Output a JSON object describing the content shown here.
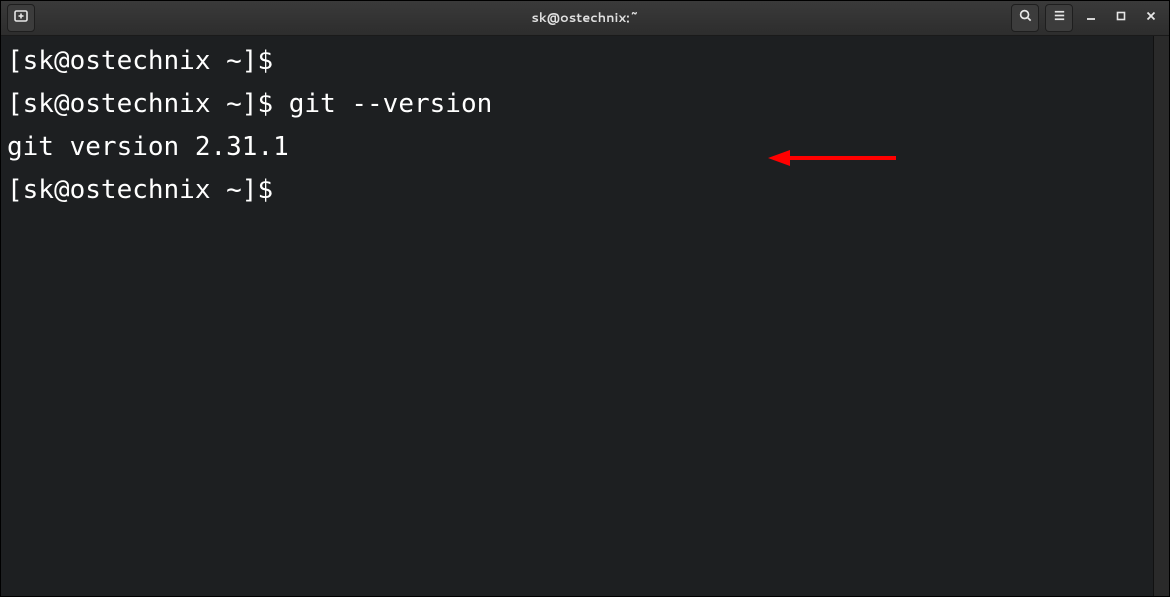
{
  "window": {
    "title": "sk@ostechnix:~"
  },
  "titlebar": {
    "new_tab_icon": "new-tab-icon",
    "search_icon": "search-icon",
    "menu_icon": "hamburger-menu-icon",
    "minimize_icon": "minimize-icon",
    "maximize_icon": "maximize-icon",
    "close_icon": "close-icon"
  },
  "terminal": {
    "lines": [
      {
        "prompt": "[sk@ostechnix ~]$ ",
        "command": ""
      },
      {
        "prompt": "[sk@ostechnix ~]$ ",
        "command": "git --version"
      },
      {
        "prompt": "",
        "command": "git version 2.31.1"
      },
      {
        "prompt": "[sk@ostechnix ~]$ ",
        "command": ""
      }
    ]
  },
  "annotation": {
    "arrow_color": "#ff0000"
  }
}
